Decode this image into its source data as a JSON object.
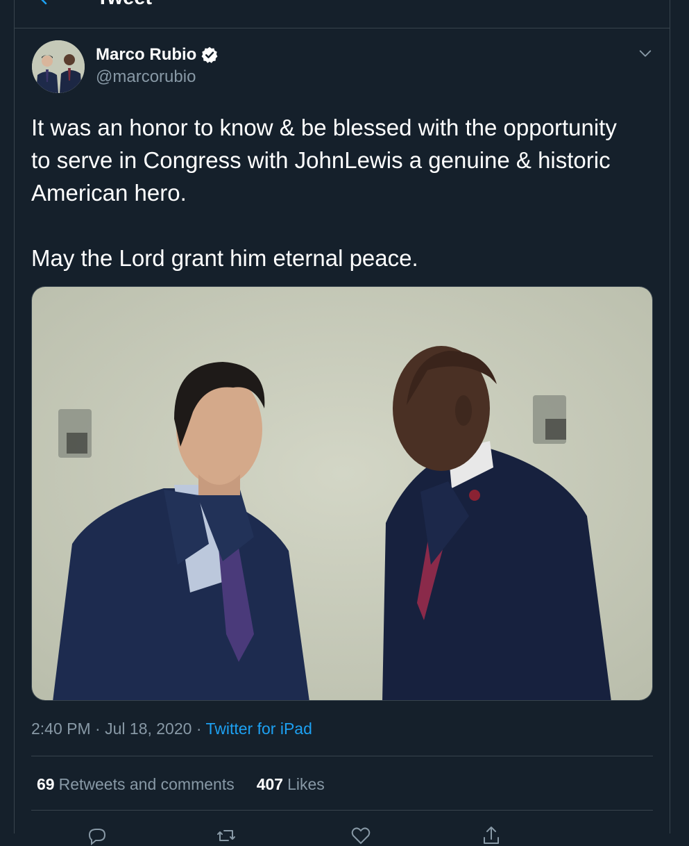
{
  "header": {
    "title": "Tweet",
    "back_icon": "back-arrow-icon"
  },
  "tweet": {
    "author": {
      "name": "Marco Rubio",
      "handle": "@marcorubio",
      "verified": true
    },
    "text": {
      "paragraph_1": "It was an honor to know & be blessed with the opportunity to serve in Congress with JohnLewis a genuine & historic American hero.",
      "paragraph_2": "May the Lord grant him eternal peace."
    },
    "meta": {
      "time": "2:40 PM",
      "separator": "·",
      "date": "Jul 18, 2020",
      "source": "Twitter for iPad"
    },
    "stats": {
      "retweets_count": "69",
      "retweets_label": "Retweets and comments",
      "likes_count": "407",
      "likes_label": "Likes"
    },
    "actions": [
      "reply-icon",
      "retweet-icon",
      "like-icon",
      "share-icon"
    ]
  },
  "colors": {
    "background": "#15202b",
    "border": "#38444d",
    "secondary_text": "#8899a6",
    "accent": "#1da1f2"
  }
}
